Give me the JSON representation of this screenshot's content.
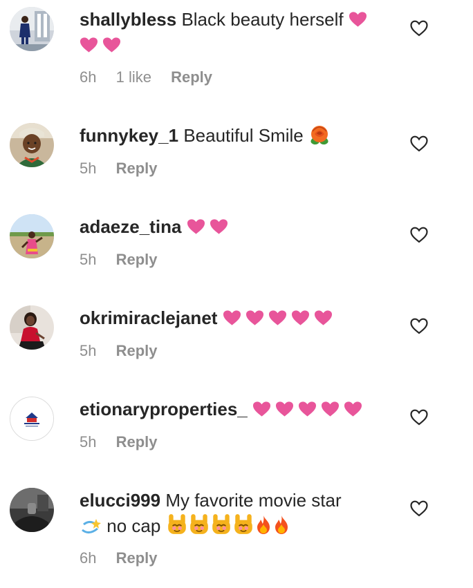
{
  "comments": [
    {
      "user": "shallybless",
      "text": "Black beauty herself",
      "time": "6h",
      "likes": "1 like",
      "reply": "Reply",
      "avatar": "avatar-photo-1"
    },
    {
      "user": "funnykey_1",
      "text": "Beautiful Smile",
      "time": "5h",
      "reply": "Reply",
      "avatar": "avatar-photo-2"
    },
    {
      "user": "adaeze_tina",
      "text": "",
      "time": "5h",
      "reply": "Reply",
      "avatar": "avatar-photo-3"
    },
    {
      "user": "okrimiraclejanet",
      "text": "",
      "time": "5h",
      "reply": "Reply",
      "avatar": "avatar-photo-4"
    },
    {
      "user": "etionaryproperties_",
      "text": "",
      "time": "5h",
      "reply": "Reply",
      "avatar": "company-logo"
    },
    {
      "user": "elucci999",
      "text": "My favorite movie star",
      "text2": "no cap",
      "time": "6h",
      "reply": "Reply",
      "avatar": "avatar-photo-6"
    }
  ],
  "colors": {
    "heart_emoji": "#e8559a",
    "meta": "#8e8e8e",
    "text": "#262626"
  },
  "icons": {
    "like": "heart-outline-icon",
    "rose": "rose-emoji",
    "dizzy": "dizzy-emoji",
    "fire": "fire-emoji",
    "rock": "sign-of-horns-emoji"
  }
}
